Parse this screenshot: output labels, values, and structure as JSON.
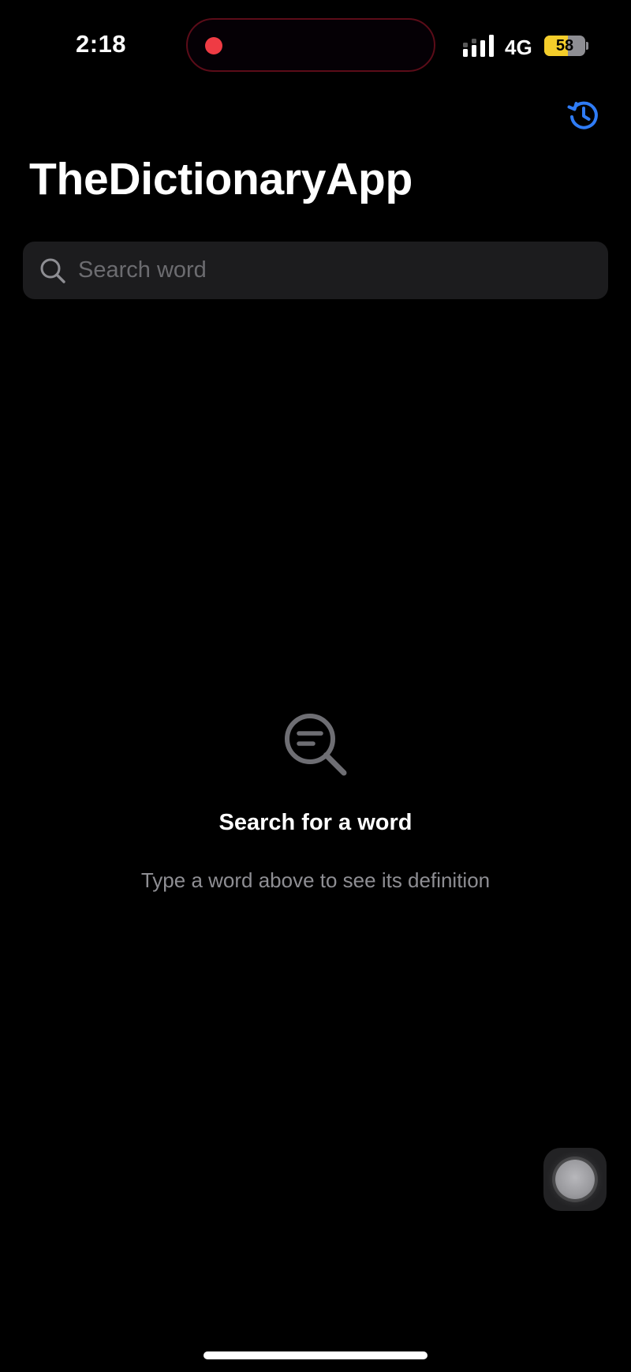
{
  "status_bar": {
    "time": "2:18",
    "network": "4G",
    "battery_level": "58",
    "battery_fraction": 0.58,
    "recording_color": "#ef3b44",
    "icons": [
      "signal-bars-icon",
      "battery-icon"
    ]
  },
  "header": {
    "title": "TheDictionaryApp",
    "history_icon": "history-icon",
    "accent_color": "#2f7cf6"
  },
  "search": {
    "placeholder": "Search word",
    "value": "",
    "icon": "search-icon"
  },
  "empty_state": {
    "icon": "search-text-icon",
    "title": "Search for a word",
    "subtitle": "Type a word above to see its definition"
  },
  "overlay": {
    "assistive_touch_icon": "assistive-touch-icon"
  }
}
